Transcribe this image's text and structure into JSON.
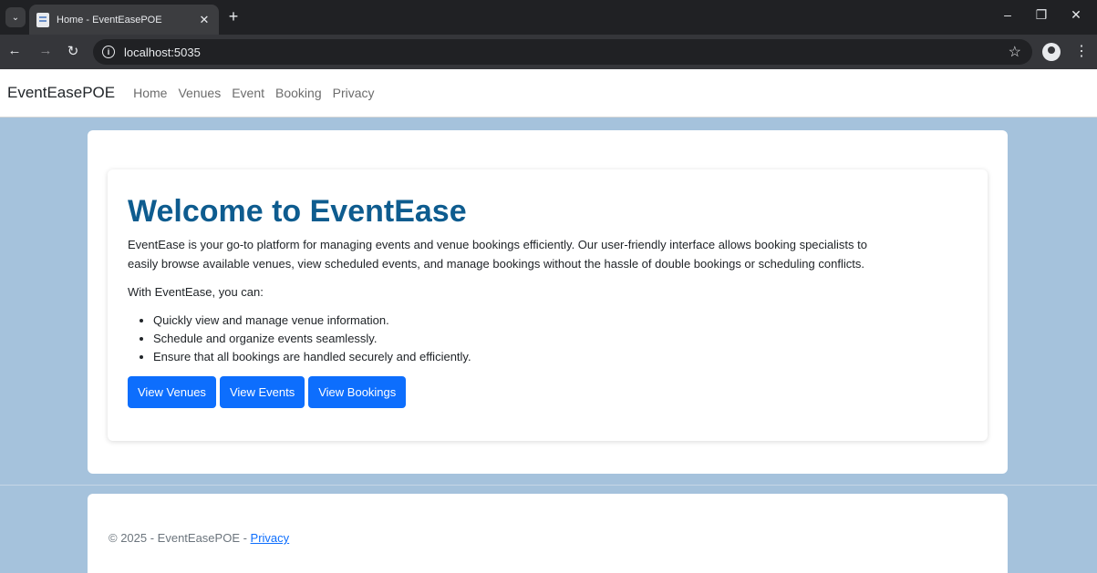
{
  "browser": {
    "tab_title": "Home - EventEasePOE",
    "url": "localhost:5035"
  },
  "navbar": {
    "brand": "EventEasePOE",
    "links": [
      "Home",
      "Venues",
      "Event",
      "Booking",
      "Privacy"
    ]
  },
  "hero": {
    "title": "Welcome to EventEase",
    "intro_line1": "EventEase is your go-to platform for managing events and venue bookings efficiently. Our user-friendly interface allows booking specialists to",
    "intro_line2": "easily browse available venues, view scheduled events, and manage bookings without the hassle of double bookings or scheduling conflicts.",
    "with_text": "With EventEase, you can:",
    "features": [
      "Quickly view and manage venue information.",
      "Schedule and organize events seamlessly.",
      "Ensure that all bookings are handled securely and efficiently."
    ],
    "buttons": [
      "View Venues",
      "View Events",
      "View Bookings"
    ]
  },
  "footer": {
    "text": "© 2025 - EventEasePOE - ",
    "privacy_link": "Privacy"
  },
  "colors": {
    "page_bg": "#a5c2dc",
    "heading": "#0e5c8f",
    "primary_button": "#0d6efd"
  }
}
